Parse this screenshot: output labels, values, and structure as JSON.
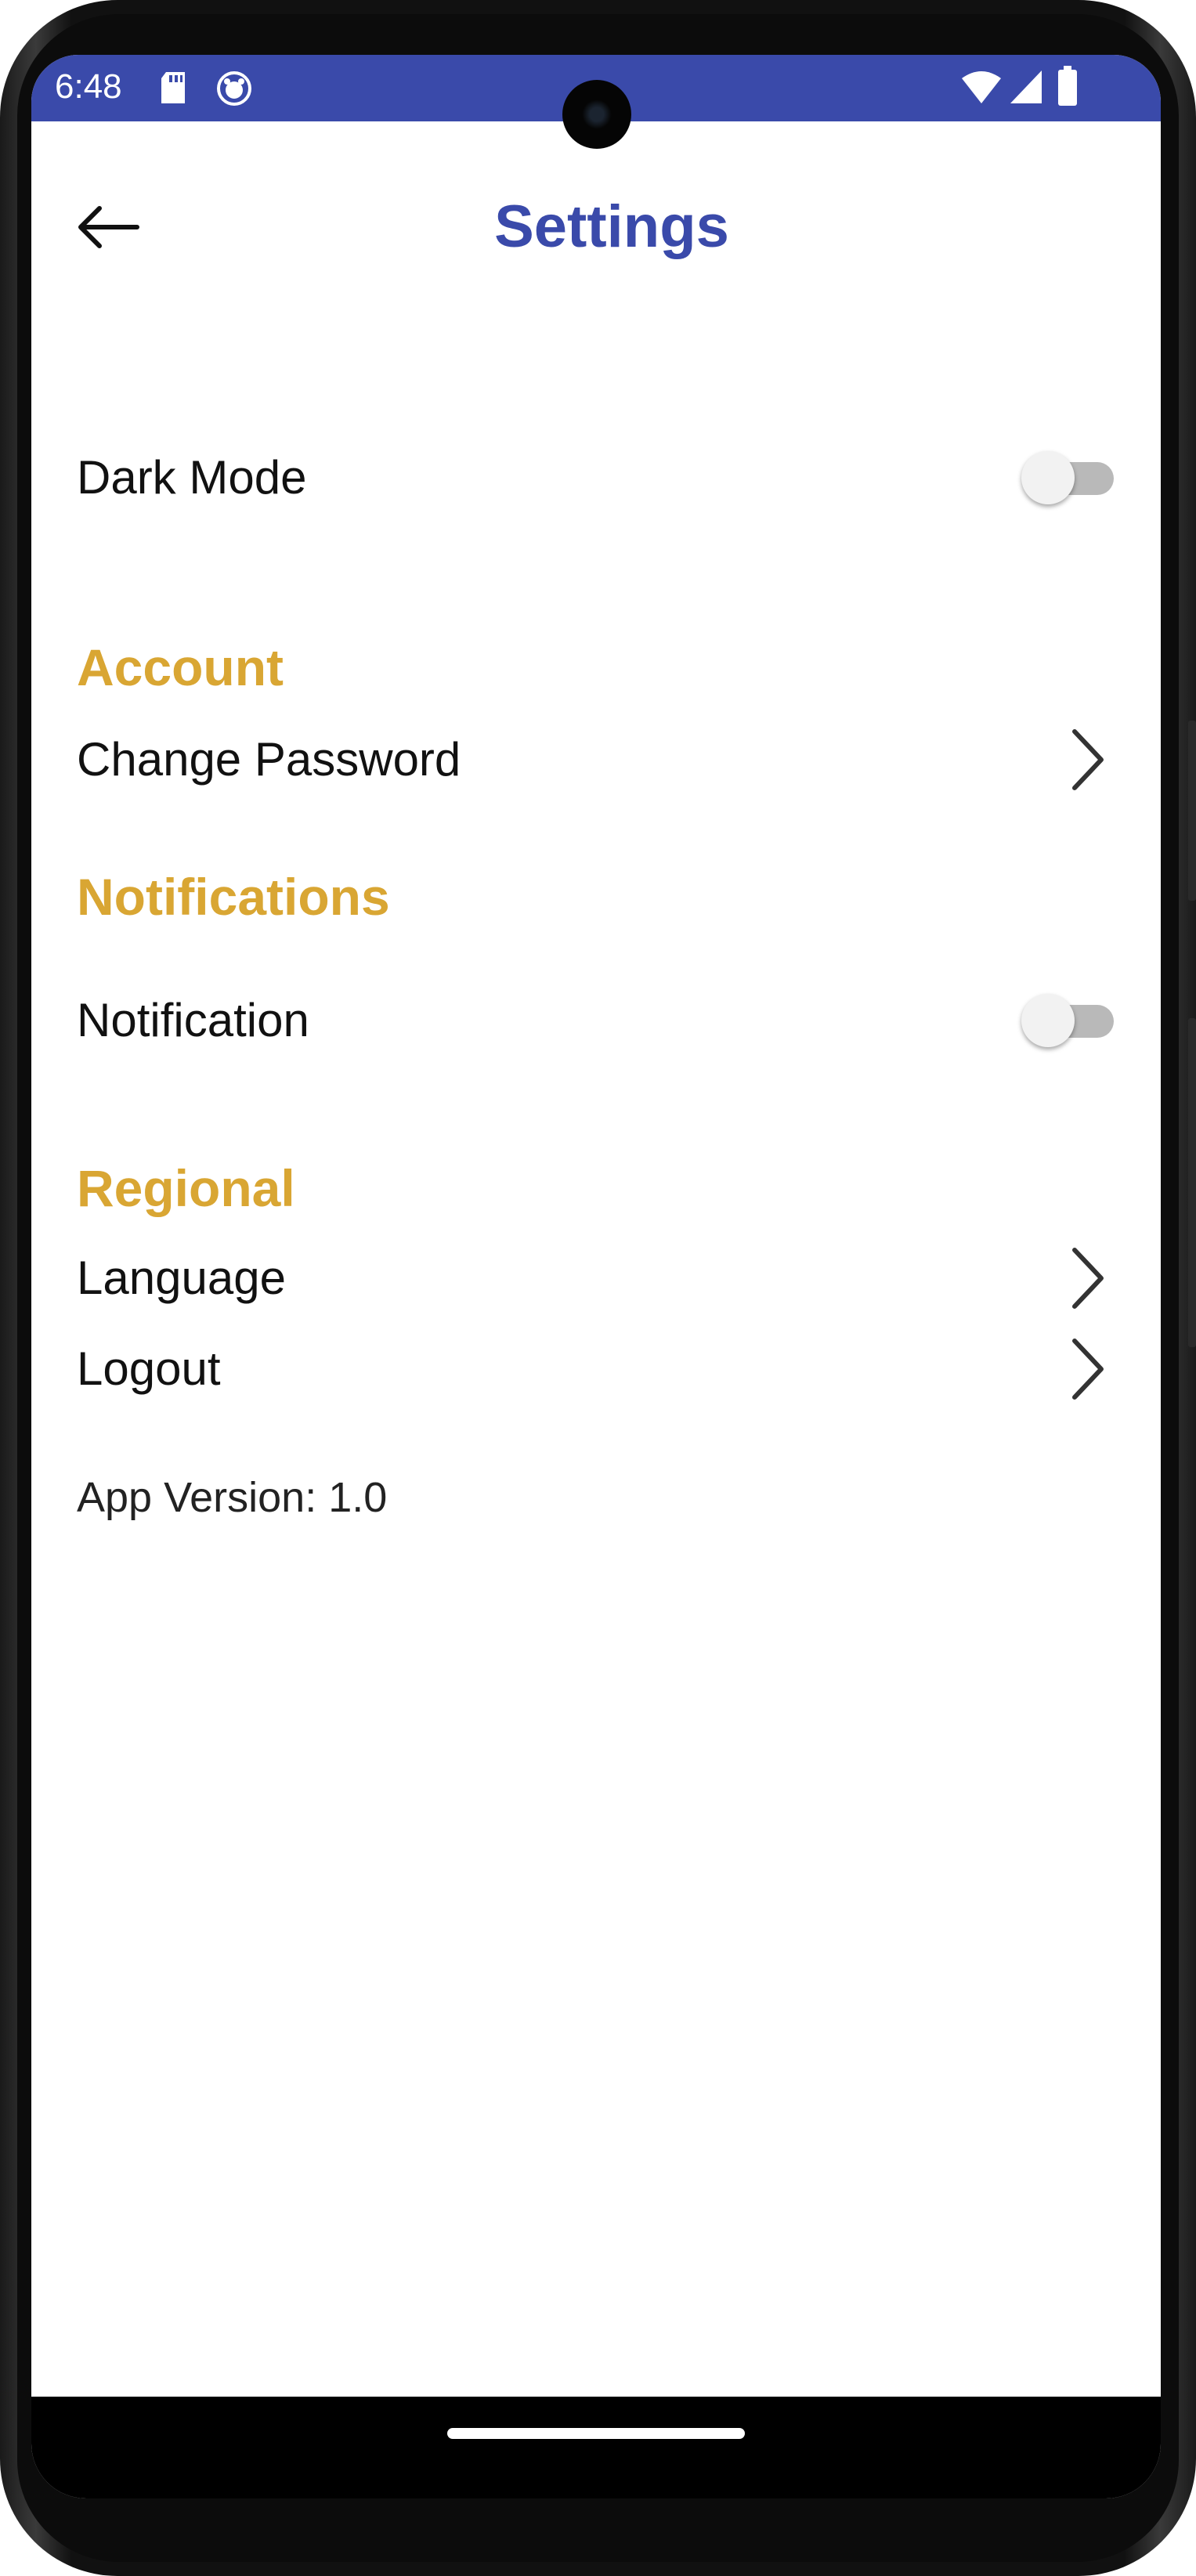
{
  "status_bar": {
    "time": "6:48",
    "left_icons": [
      "sd-card-icon",
      "app-notification-icon"
    ],
    "right_icons": [
      "wifi-icon",
      "signal-icon",
      "battery-icon"
    ],
    "color": "#3a4aaa"
  },
  "header": {
    "title": "Settings",
    "back_icon": "arrow-left-icon"
  },
  "settings": {
    "dark_mode": {
      "label": "Dark Mode",
      "enabled": false
    },
    "account": {
      "header": "Account",
      "change_password": "Change Password"
    },
    "notifications": {
      "header": "Notifications",
      "notification": {
        "label": "Notification",
        "enabled": false
      }
    },
    "regional": {
      "header": "Regional",
      "language": "Language",
      "logout": "Logout"
    }
  },
  "footer": {
    "app_version": "App Version: 1.0"
  },
  "colors": {
    "primary": "#3a4aaa",
    "section_header": "#d9a633",
    "text": "#111111"
  }
}
